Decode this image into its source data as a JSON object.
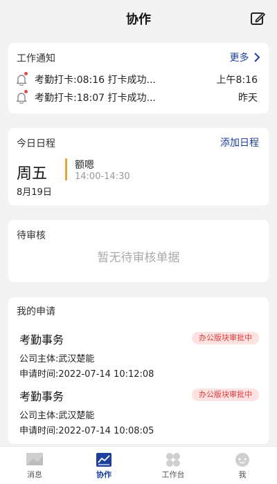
{
  "header": {
    "title": "协作",
    "edit_icon": "edit-icon"
  },
  "notice": {
    "title": "工作通知",
    "more_label": "更多",
    "items": [
      {
        "text": "考勤打卡:08:16 打卡成功...",
        "time": "上午8:16"
      },
      {
        "text": "考勤打卡:18:07 打卡成功...",
        "time": "昨天"
      }
    ]
  },
  "schedule": {
    "title": "今日日程",
    "add_label": "添加日程",
    "weekday": "周五",
    "date": "8月19日",
    "event": {
      "name": "额嗯",
      "time": "14:00-14:30"
    }
  },
  "pending": {
    "title": "待审核",
    "empty_text": "暂无待审核单据"
  },
  "applications": {
    "title": "我的申请",
    "items": [
      {
        "type": "考勤事务",
        "status": "办公版块审批中",
        "company": "公司主体:武汉楚能",
        "time": "申请时间:2022-07-14 10:12:08"
      },
      {
        "type": "考勤事务",
        "status": "办公版块审批中",
        "company": "公司主体:武汉楚能",
        "time": "申请时间:2022-07-14 10:08:05"
      }
    ]
  },
  "nav": {
    "items": [
      {
        "label": "消息",
        "icon": "message-icon"
      },
      {
        "label": "协作",
        "icon": "collaboration-icon"
      },
      {
        "label": "工作台",
        "icon": "workbench-icon"
      },
      {
        "label": "我",
        "icon": "profile-icon"
      }
    ],
    "active_index": 1
  },
  "colors": {
    "accent": "#1d3f9e",
    "badge_bg": "#fde2e2",
    "badge_text": "#e23b3b",
    "event_bar": "#e6a23c"
  }
}
